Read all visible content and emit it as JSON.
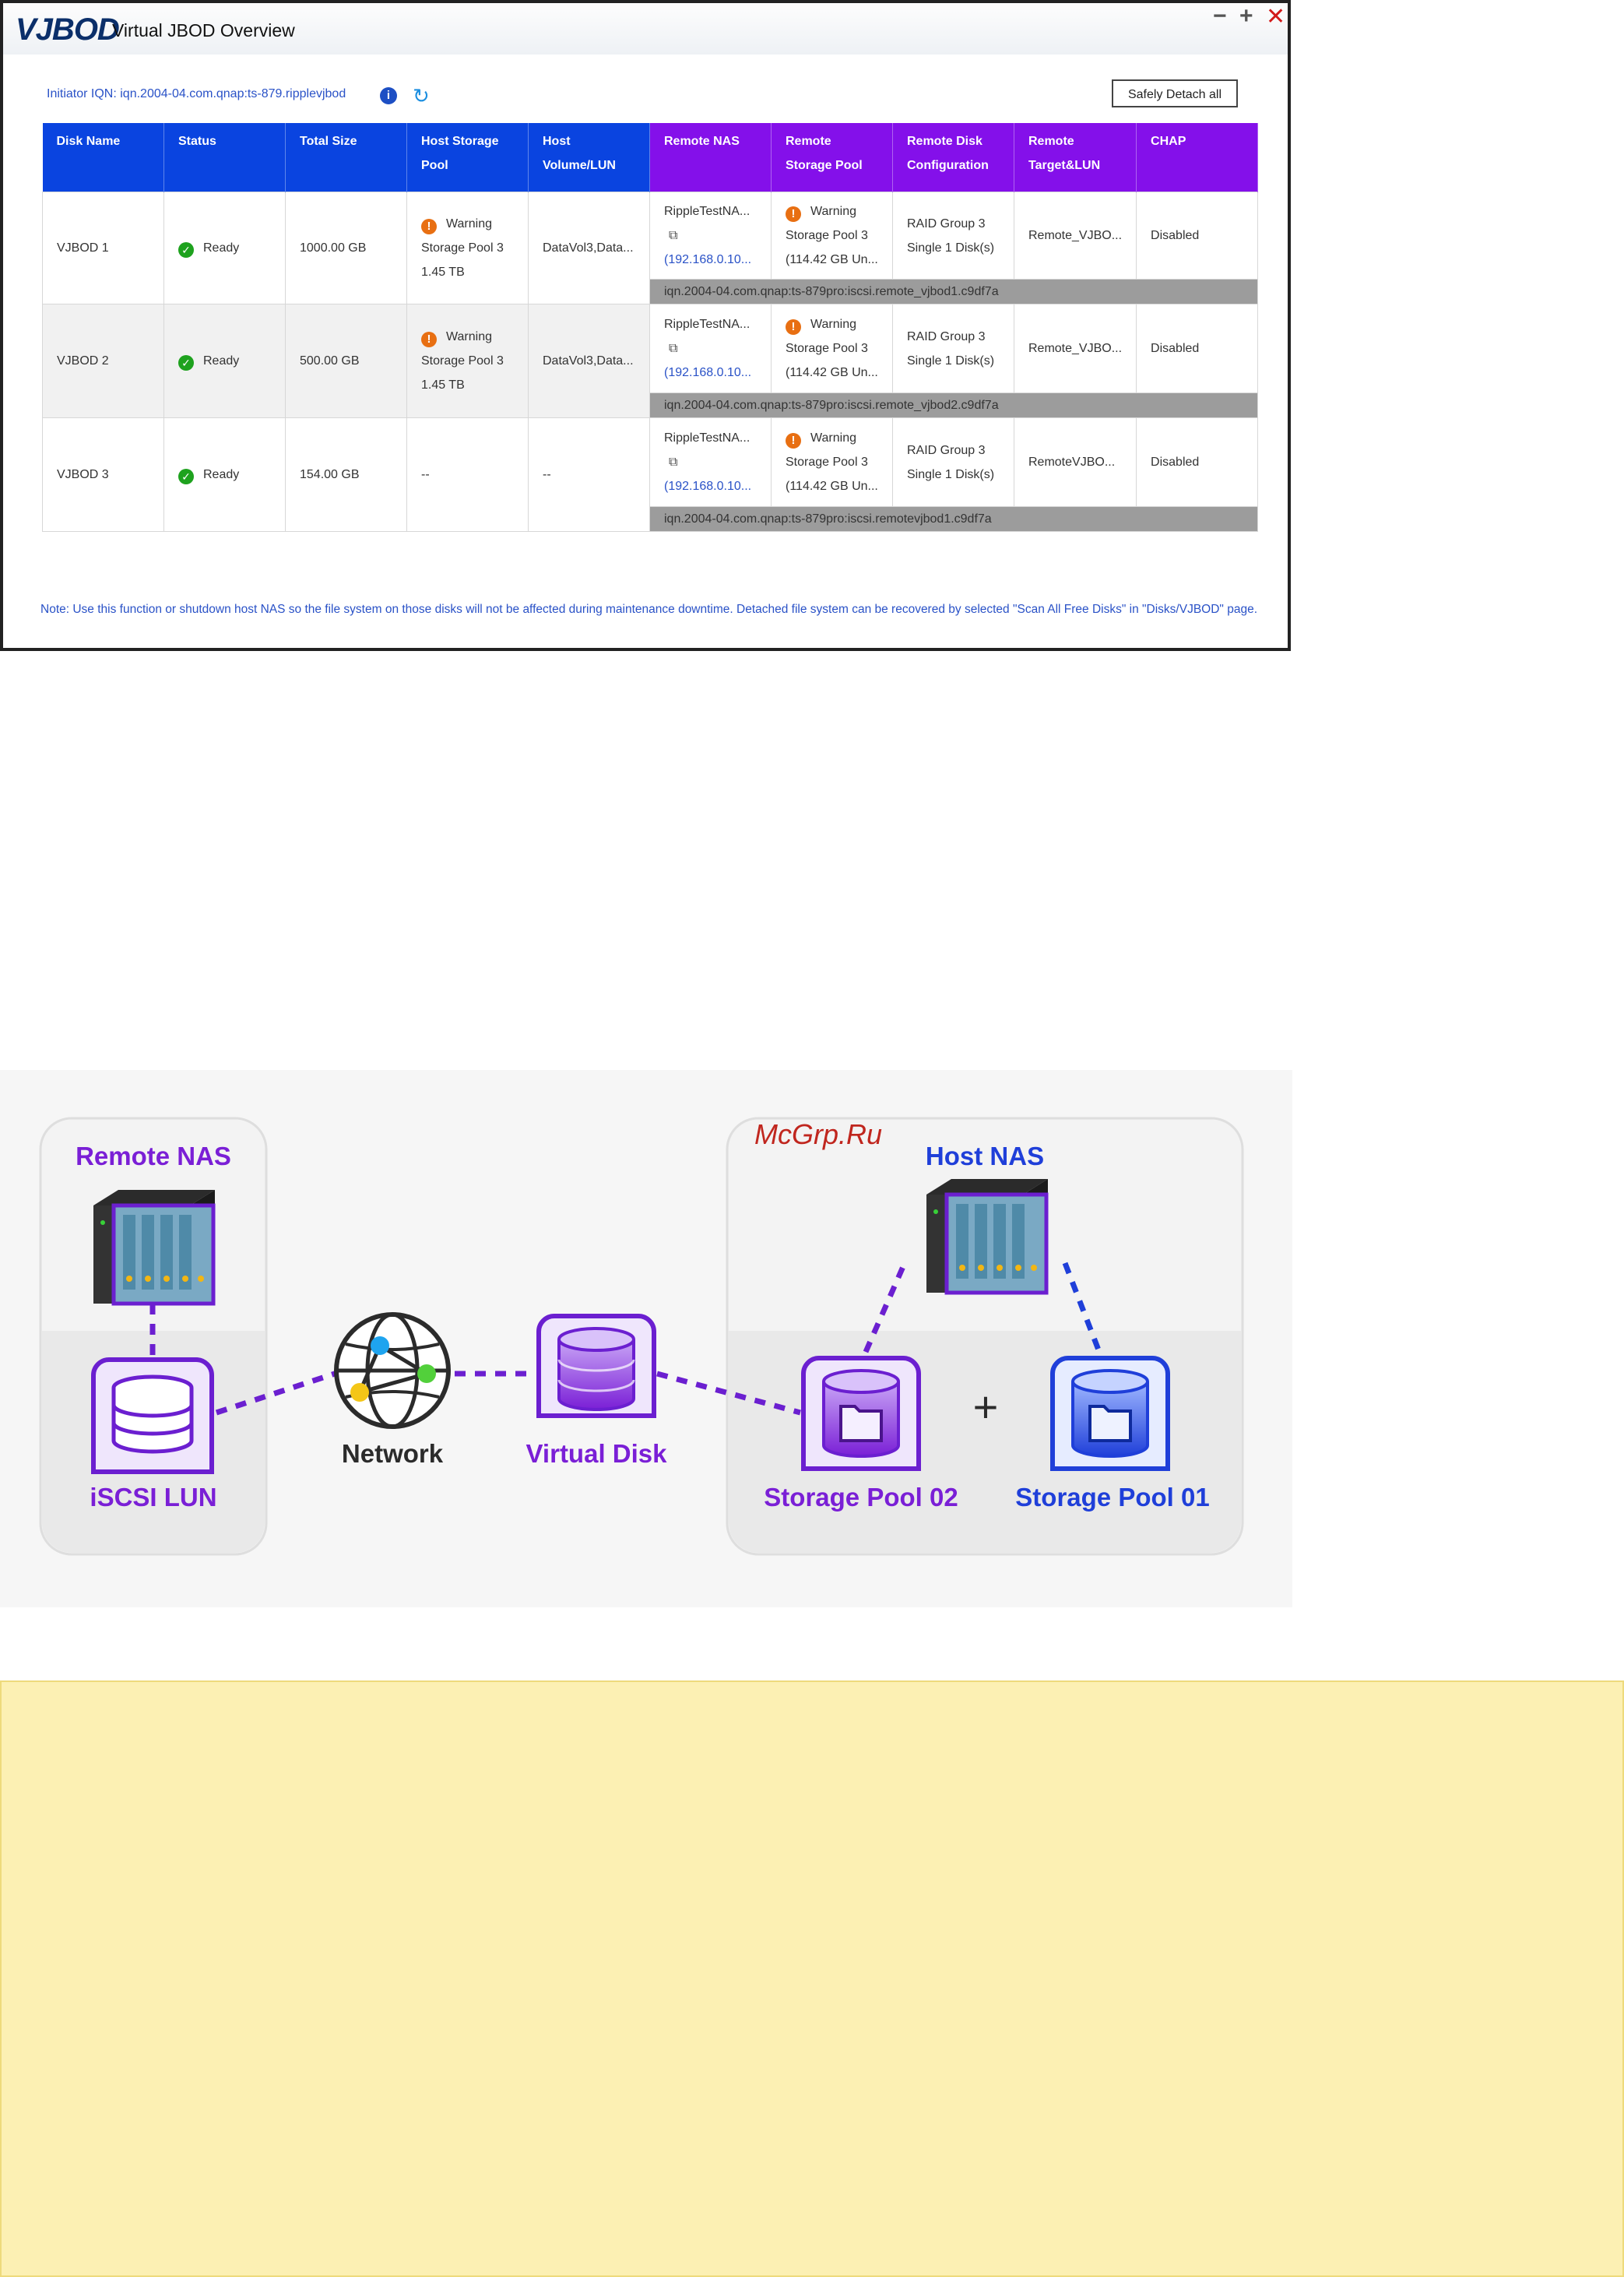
{
  "window": {
    "logo": "VJBOD",
    "title": "Virtual JBOD Overview",
    "controls": {
      "minimize": "−",
      "maximize": "+",
      "close": "✕"
    }
  },
  "toolbar": {
    "initiator_iqn": "Initiator IQN: iqn.2004-04.com.qnap:ts-879.ripplevjbod",
    "info_icon": "i",
    "refresh_icon": "↻",
    "detach_button": "Safely Detach all"
  },
  "table": {
    "headers": [
      "Disk Name",
      "Status",
      "Total Size",
      "Host Storage Pool",
      "Host Volume/LUN",
      "Remote NAS",
      "Remote Storage Pool",
      "Remote Disk Configuration",
      "Remote Target&LUN",
      "CHAP"
    ],
    "rows": [
      {
        "disk": "VJBOD 1",
        "status": "Ready",
        "size": "1000.00 GB",
        "host_pool_status": "Warning",
        "host_pool": "Storage Pool 3",
        "host_pool_size": "1.45 TB",
        "host_volume": "DataVol3,Data...",
        "remote_nas": "RippleTestNA...",
        "remote_ip": "(192.168.0.10...",
        "remote_pool_status": "Warning",
        "remote_pool": "Storage Pool 3",
        "remote_pool_free": "(114.42 GB Un...",
        "raid": "RAID Group 3",
        "raid_disks": "Single 1 Disk(s)",
        "target": "Remote_VJBO...",
        "chap": "Disabled",
        "iqn": "iqn.2004-04.com.qnap:ts-879pro:iscsi.remote_vjbod1.c9df7a"
      },
      {
        "disk": "VJBOD 2",
        "status": "Ready",
        "size": "500.00 GB",
        "host_pool_status": "Warning",
        "host_pool": "Storage Pool 3",
        "host_pool_size": "1.45 TB",
        "host_volume": "DataVol3,Data...",
        "remote_nas": "RippleTestNA...",
        "remote_ip": "(192.168.0.10...",
        "remote_pool_status": "Warning",
        "remote_pool": "Storage Pool 3",
        "remote_pool_free": "(114.42 GB Un...",
        "raid": "RAID Group 3",
        "raid_disks": "Single 1 Disk(s)",
        "target": "Remote_VJBO...",
        "chap": "Disabled",
        "iqn": "iqn.2004-04.com.qnap:ts-879pro:iscsi.remote_vjbod2.c9df7a"
      },
      {
        "disk": "VJBOD 3",
        "status": "Ready",
        "size": "154.00 GB",
        "host_pool": "--",
        "host_volume": "--",
        "remote_nas": "RippleTestNA...",
        "remote_ip": "(192.168.0.10...",
        "remote_pool_status": "Warning",
        "remote_pool": "Storage Pool 3",
        "remote_pool_free": "(114.42 GB Un...",
        "raid": "RAID Group 3",
        "raid_disks": "Single 1 Disk(s)",
        "target": "RemoteVJBO...",
        "chap": "Disabled",
        "iqn": "iqn.2004-04.com.qnap:ts-879pro:iscsi.remotevjbod1.c9df7a"
      }
    ]
  },
  "note": "Note: Use this function or shutdown host NAS so the file system on those disks will not be affected during maintenance downtime. Detached file system can be recovered by selected \"Scan All Free Disks\" in \"Disks/VJBOD\" page.",
  "diagram": {
    "remote_nas": "Remote NAS",
    "iscsi_lun": "iSCSI LUN",
    "network": "Network",
    "virtual_disk": "Virtual Disk",
    "host_nas": "Host NAS",
    "pool02": "Storage Pool 02",
    "pool01": "Storage Pool 01",
    "plus": "+",
    "watermark": "McGrp.Ru",
    "colors": {
      "purple": "#7a1fd6",
      "blue": "#1f3fd9",
      "dark": "#2b2b2b"
    }
  }
}
